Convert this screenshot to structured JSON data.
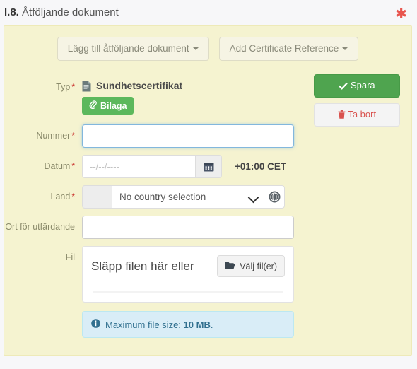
{
  "section": {
    "number": "I.8.",
    "title": "Åtföljande dokument",
    "required_marker": "✱"
  },
  "toolbar": {
    "add_document_label": "Lägg till åtföljande dokument",
    "add_certificate_reference_label": "Add Certificate Reference"
  },
  "actions": {
    "save_label": "Spara",
    "delete_label": "Ta bort"
  },
  "form": {
    "type": {
      "label": "Typ",
      "required": "*",
      "value": "Sundhetscertifikat",
      "badge_label": "Bilaga"
    },
    "number": {
      "label": "Nummer",
      "required": "*",
      "value": "",
      "placeholder": ""
    },
    "date": {
      "label": "Datum",
      "required": "*",
      "value": "",
      "placeholder": "--/--/----",
      "timezone": "+01:00 CET"
    },
    "country": {
      "label": "Land",
      "required": "*",
      "prefix": "",
      "selected": "No country selection"
    },
    "place_of_issue": {
      "label": "Ort för utfärdande",
      "value": "",
      "placeholder": ""
    },
    "file": {
      "label": "Fil",
      "drop_text": "Släpp filen här eller",
      "choose_button_label": "Välj fil(er)",
      "info_prefix": "Maximum file size:",
      "info_size": "10 MB",
      "info_suffix": "."
    }
  },
  "icons": {
    "document": "document-icon",
    "paperclip": "paperclip-icon",
    "calendar": "calendar-icon",
    "globe": "globe-icon",
    "folder": "folder-open-icon",
    "check": "check-icon",
    "trash": "trash-icon",
    "info": "info-circle-icon"
  },
  "colors": {
    "panel_bg": "#f5f3d0",
    "accent_green": "#5cb85c",
    "danger_red": "#d9534f",
    "info_blue": "#d9edf7",
    "focus_blue": "#82b7dd"
  }
}
